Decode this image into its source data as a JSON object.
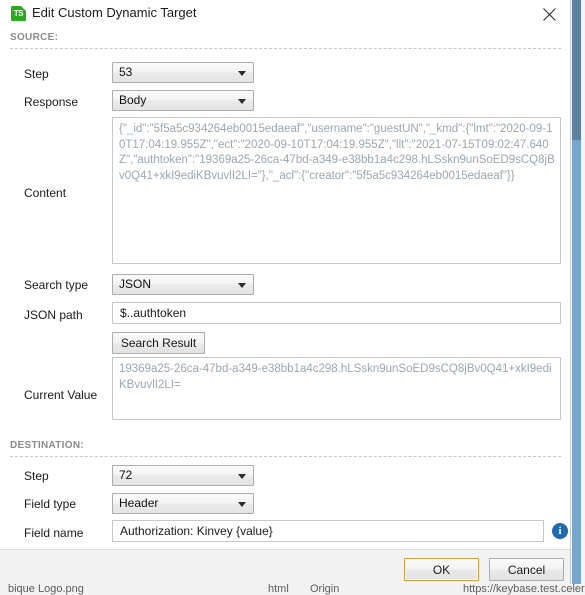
{
  "window": {
    "title": "Edit Custom Dynamic Target",
    "app_icon_label": "TS",
    "close_icon": "close-icon",
    "accent_green": "#2aaa1e",
    "default_button_border": "#d99b3d"
  },
  "sections": {
    "source": {
      "label": "SOURCE:",
      "step": {
        "label": "Step",
        "value": "53"
      },
      "response": {
        "label": "Response",
        "value": "Body"
      },
      "content": {
        "label": "Content",
        "value": "{\"_id\":\"5f5a5c934264eb0015edaeaf\",\"username\":\"guestUN\",\"_kmd\":{\"lmt\":\"2020-09-10T17:04:19.955Z\",\"ect\":\"2020-09-10T17:04:19.955Z\",\"llt\":\"2021-07-15T09:02:47.640Z\",\"authtoken\":\"19369a25-26ca-47bd-a349-e38bb1a4c298.hLSskn9unSoED9sCQ8jBv0Q41+xkI9ediKBvuvlI2LI=\"},\"_acl\":{\"creator\":\"5f5a5c934264eb0015edaeaf\"}}"
      },
      "search_type": {
        "label": "Search type",
        "value": "JSON"
      },
      "json_path": {
        "label": "JSON path",
        "value": "$..authtoken"
      },
      "search_result_button": "Search Result",
      "current_value": {
        "label": "Current Value",
        "value": "19369a25-26ca-47bd-a349-e38bb1a4c298.hLSskn9unSoED9sCQ8jBv0Q41+xkI9ediKBvuvlI2LI="
      }
    },
    "destination": {
      "label": "DESTINATION:",
      "step": {
        "label": "Step",
        "value": "72"
      },
      "field_type": {
        "label": "Field type",
        "value": "Header"
      },
      "field_name": {
        "label": "Field name",
        "value": "Authorization: Kinvey {value}"
      },
      "info_icon": "info-icon",
      "info_glyph": "i"
    }
  },
  "footer": {
    "ok_label": "OK",
    "cancel_label": "Cancel"
  },
  "background": {
    "ghost_left": "bique Logo.png",
    "ghost_mid": "html",
    "ghost_col": "Origin",
    "ghost_right": "https://keybase.test.celer"
  }
}
